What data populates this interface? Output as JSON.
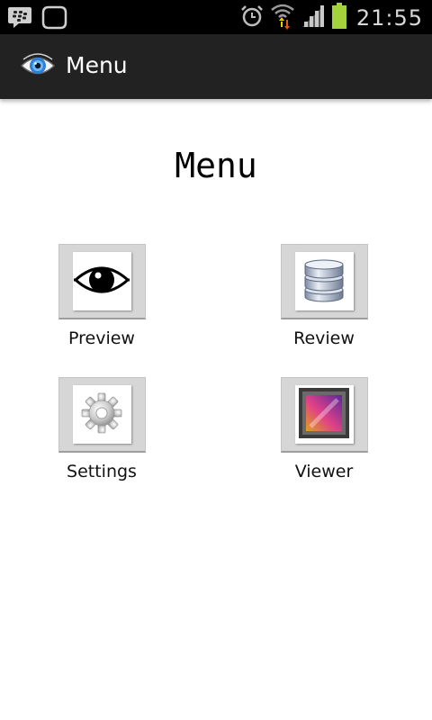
{
  "status_bar": {
    "time": "21:55",
    "icons": [
      "bbm-icon",
      "chat-bubble-icon",
      "alarm-icon",
      "wifi-icon",
      "signal-icon",
      "battery-icon"
    ],
    "battery_color": "#a4d23a"
  },
  "action_bar": {
    "title": "Menu",
    "icon": "eye-icon",
    "background": "#222222"
  },
  "page": {
    "title": "Menu"
  },
  "menu": {
    "items": [
      {
        "label": "Preview",
        "icon": "eye-icon"
      },
      {
        "label": "Review",
        "icon": "database-icon"
      },
      {
        "label": "Settings",
        "icon": "gear-icon"
      },
      {
        "label": "Viewer",
        "icon": "gallery-icon"
      }
    ]
  }
}
